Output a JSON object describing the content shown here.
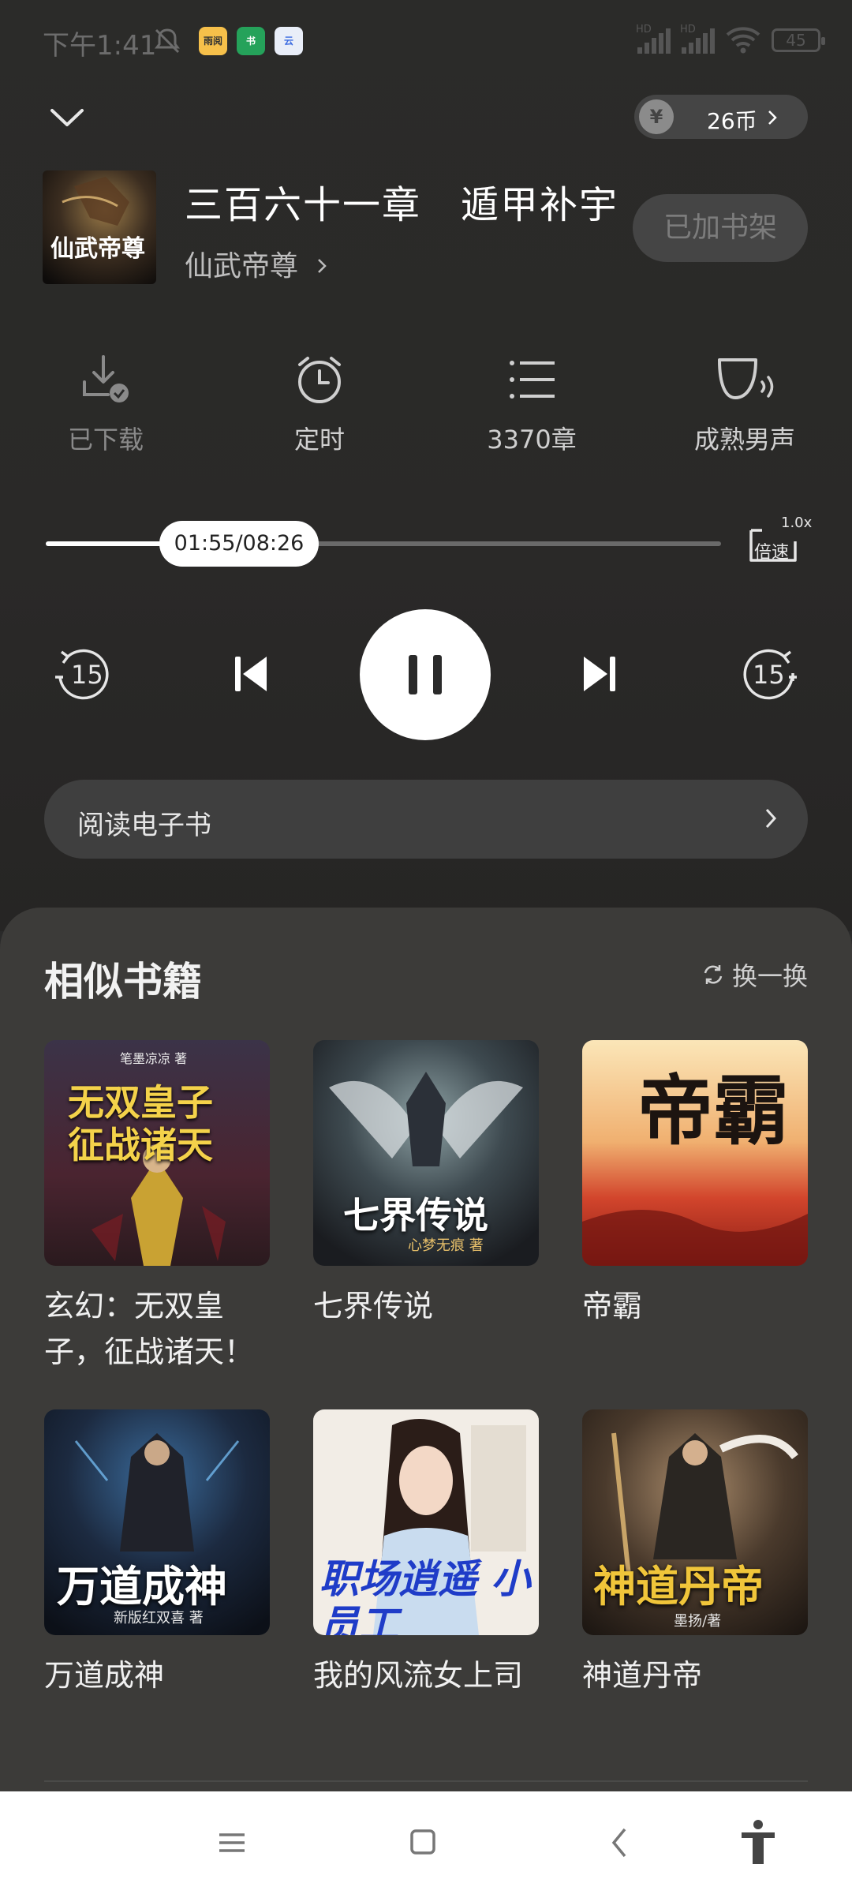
{
  "status_bar": {
    "time": "下午1:41",
    "apps": [
      {
        "name": "雨阅",
        "color": "#f6c04a"
      },
      {
        "name": "书",
        "color": "#25a25a"
      },
      {
        "name": "云",
        "color": "#e9eef8"
      }
    ],
    "signal_label": "HD",
    "battery": "45"
  },
  "header": {
    "coins": "26币"
  },
  "now_playing": {
    "chapter_title": "三百六十一章　遁甲补宇",
    "book_name": "仙武帝尊",
    "shelf_button": "已加书架",
    "cover_text": "仙武帝尊"
  },
  "actions": [
    {
      "label": "已下载",
      "icon": "download-done-icon"
    },
    {
      "label": "定时",
      "icon": "alarm-clock-icon"
    },
    {
      "label": "3370章",
      "icon": "list-icon"
    },
    {
      "label": "成熟男声",
      "icon": "voice-icon"
    }
  ],
  "progress": {
    "time_text": "01:55/08:26",
    "fraction": 0.228,
    "speed_value": "1.0x",
    "speed_label": "倍速"
  },
  "controls": {
    "rewind_label": "15",
    "forward_label": "15"
  },
  "read_ebook": "阅读电子书",
  "similar": {
    "title": "相似书籍",
    "refresh": "换一换",
    "books": [
      {
        "title": "玄幻：无双皇子，征战诸天！",
        "cover_text": "无双皇子 征战诸天",
        "cover_sub": "笔墨凉凉 著"
      },
      {
        "title": "七界传说",
        "cover_text": "七界传说",
        "cover_sub": "心梦无痕 著"
      },
      {
        "title": "帝霸",
        "cover_text": "帝霸",
        "cover_sub": ""
      },
      {
        "title": "万道成神",
        "cover_text": "万道成神",
        "cover_sub": "新版红双喜 著"
      },
      {
        "title": "我的风流女上司",
        "cover_text": "职场逍遥 小员工",
        "cover_sub": ""
      },
      {
        "title": "神道丹帝",
        "cover_text": "神道丹帝",
        "cover_sub": "墨扬/著"
      }
    ]
  }
}
